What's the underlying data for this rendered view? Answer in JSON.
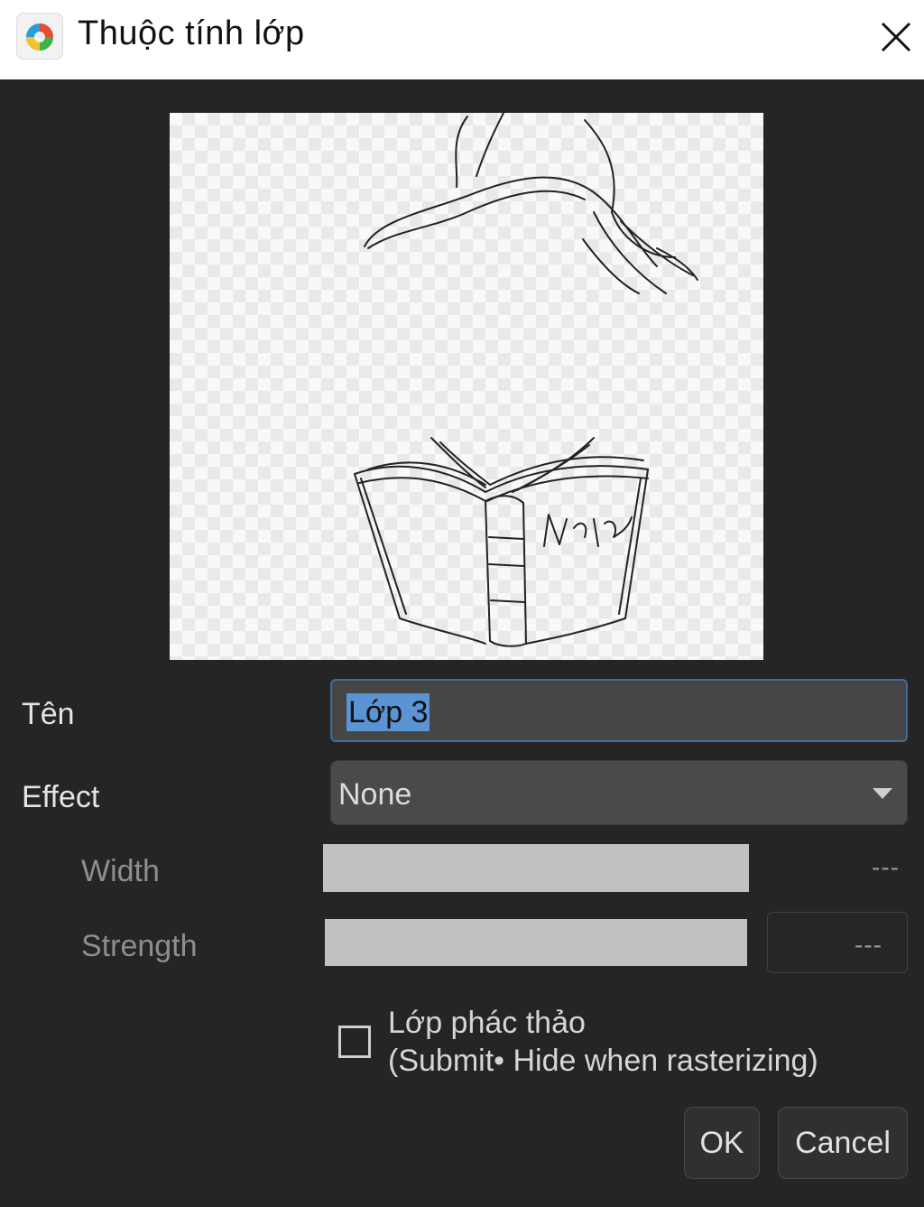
{
  "window": {
    "title": "Thuộc tính lớp",
    "app_icon": "medibang-palette-icon",
    "close_icon": "close-icon"
  },
  "preview": {
    "description_icon": "layer-preview-thumbnail"
  },
  "form": {
    "name_label": "Tên",
    "name_value": "Lớp 3",
    "effect_label": "Effect",
    "effect_value": "None",
    "width_label": "Width",
    "width_value": "---",
    "strength_label": "Strength",
    "strength_value": "---",
    "draft_line1": "Lớp phác thảo",
    "draft_line2": "(Submit• Hide when rasterizing)",
    "draft_checked": false
  },
  "buttons": {
    "ok": "OK",
    "cancel": "Cancel"
  },
  "colors": {
    "background": "#252525",
    "selection": "#5b94d4",
    "input_border": "#3e6c9b"
  }
}
